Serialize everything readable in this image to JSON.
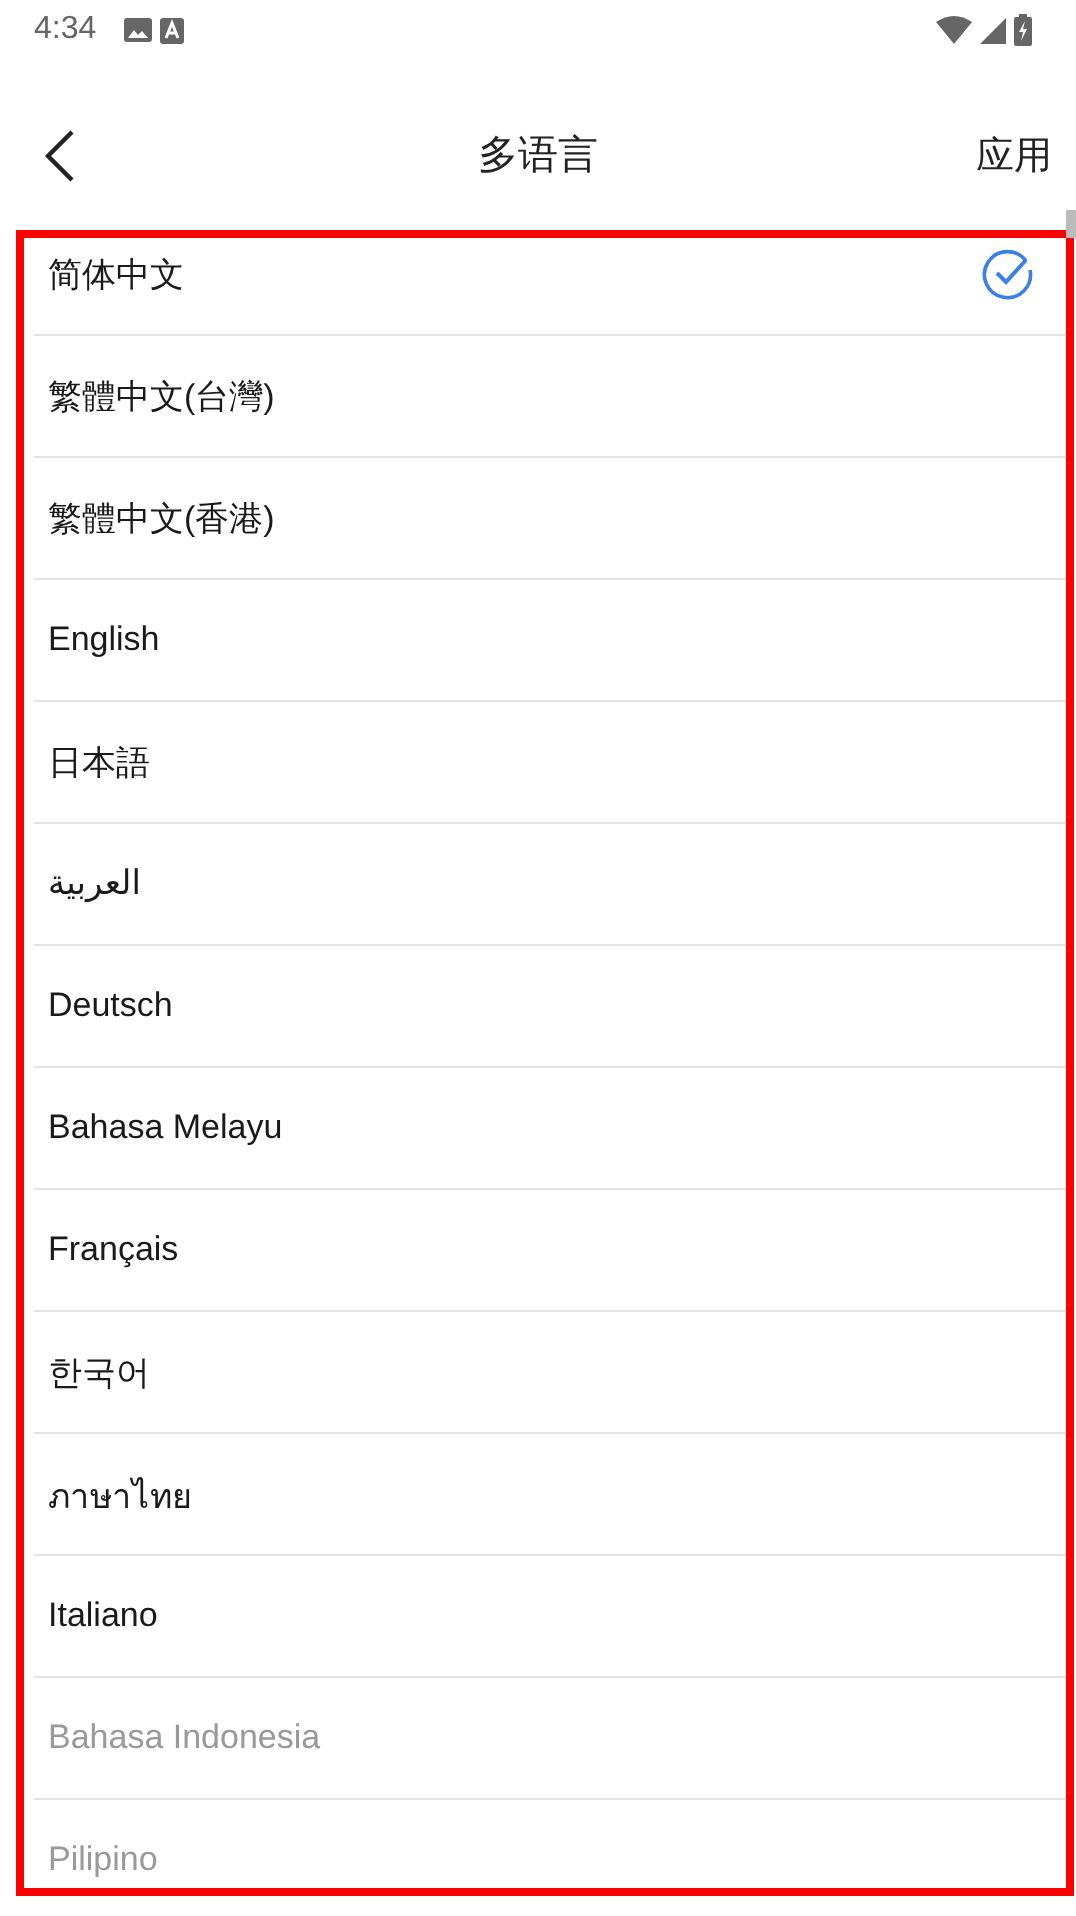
{
  "status_bar": {
    "time": "4:34"
  },
  "toolbar": {
    "title": "多语言",
    "action": "应用"
  },
  "languages": [
    {
      "label": "简体中文",
      "selected": true,
      "disabled": false
    },
    {
      "label": "繁體中文(台灣)",
      "selected": false,
      "disabled": false
    },
    {
      "label": "繁體中文(香港)",
      "selected": false,
      "disabled": false
    },
    {
      "label": "English",
      "selected": false,
      "disabled": false
    },
    {
      "label": "日本語",
      "selected": false,
      "disabled": false
    },
    {
      "label": "العربية",
      "selected": false,
      "disabled": false
    },
    {
      "label": "Deutsch",
      "selected": false,
      "disabled": false
    },
    {
      "label": "Bahasa Melayu",
      "selected": false,
      "disabled": false
    },
    {
      "label": "Français",
      "selected": false,
      "disabled": false
    },
    {
      "label": "한국어",
      "selected": false,
      "disabled": false
    },
    {
      "label": "ภาษาไทย",
      "selected": false,
      "disabled": false
    },
    {
      "label": "Italiano",
      "selected": false,
      "disabled": false
    },
    {
      "label": "Bahasa Indonesia",
      "selected": false,
      "disabled": true
    },
    {
      "label": "Pilipino",
      "selected": false,
      "disabled": true
    }
  ]
}
